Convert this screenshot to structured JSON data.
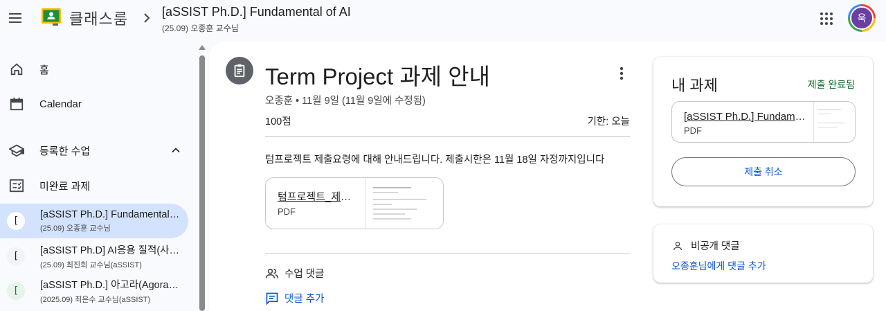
{
  "header": {
    "menu_icon": "hamburger-menu-icon",
    "app_name": "클래스룸",
    "course_title": "[aSSIST Ph.D.] Fundamental of AI",
    "course_subtitle": "(25.09) 오종훈 교수님",
    "avatar_letter": "욱"
  },
  "sidebar": {
    "home": "홈",
    "calendar": "Calendar",
    "enrolled_section": "등록한 수업",
    "todo": "미완료 과제",
    "courses": [
      {
        "badge": "[",
        "title": "[aSSIST Ph.D.] Fundamental of AI",
        "subtitle": "(25.09) 오종훈 교수님",
        "badge_color": "#1f1f1f",
        "badge_bg": "#ffffff"
      },
      {
        "badge": "[",
        "title": "[aSSIST Ph.D] AI응용 질적(사회과학)",
        "subtitle": "(25.09) 최진희 교수님(aSSIST)",
        "badge_color": "#1f1f1f",
        "badge_bg": "#f1f3f4"
      },
      {
        "badge": "[",
        "title": "[aSSIST Ph.D.] 아고라(Agora) 세미나",
        "subtitle": "(2025.09) 최은수 교수님(aSSIST)",
        "badge_color": "#188038",
        "badge_bg": "#e6f4ea"
      }
    ]
  },
  "assignment": {
    "title": "Term Project 과제 안내",
    "meta": "오종훈 • 11월 9일 (11월 9일에 수정됨)",
    "points": "100점",
    "due": "기한: 오늘",
    "description": "텀프로젝트 제출요령에 대해 안내드립니다. 제출시한은 11월 18일 자정까지입니다",
    "attachment": {
      "name": "텀프로젝트_제출요령",
      "type": "PDF"
    },
    "class_comments_label": "수업 댓글",
    "add_comment_label": "댓글 추가"
  },
  "my_work": {
    "title": "내 과제",
    "status": "제출 완료됨",
    "file_name": "[aSSIST Ph.D.] Fundamental of AI",
    "file_type": "PDF",
    "unsubmit_label": "제출 취소"
  },
  "private_comments": {
    "title": "비공개 댓글",
    "add_link": "오종훈님에게 댓글 추가"
  },
  "colors": {
    "accent": "#0b57d0",
    "selected_bg": "#d3e3fd",
    "status_green": "#146c2e"
  }
}
